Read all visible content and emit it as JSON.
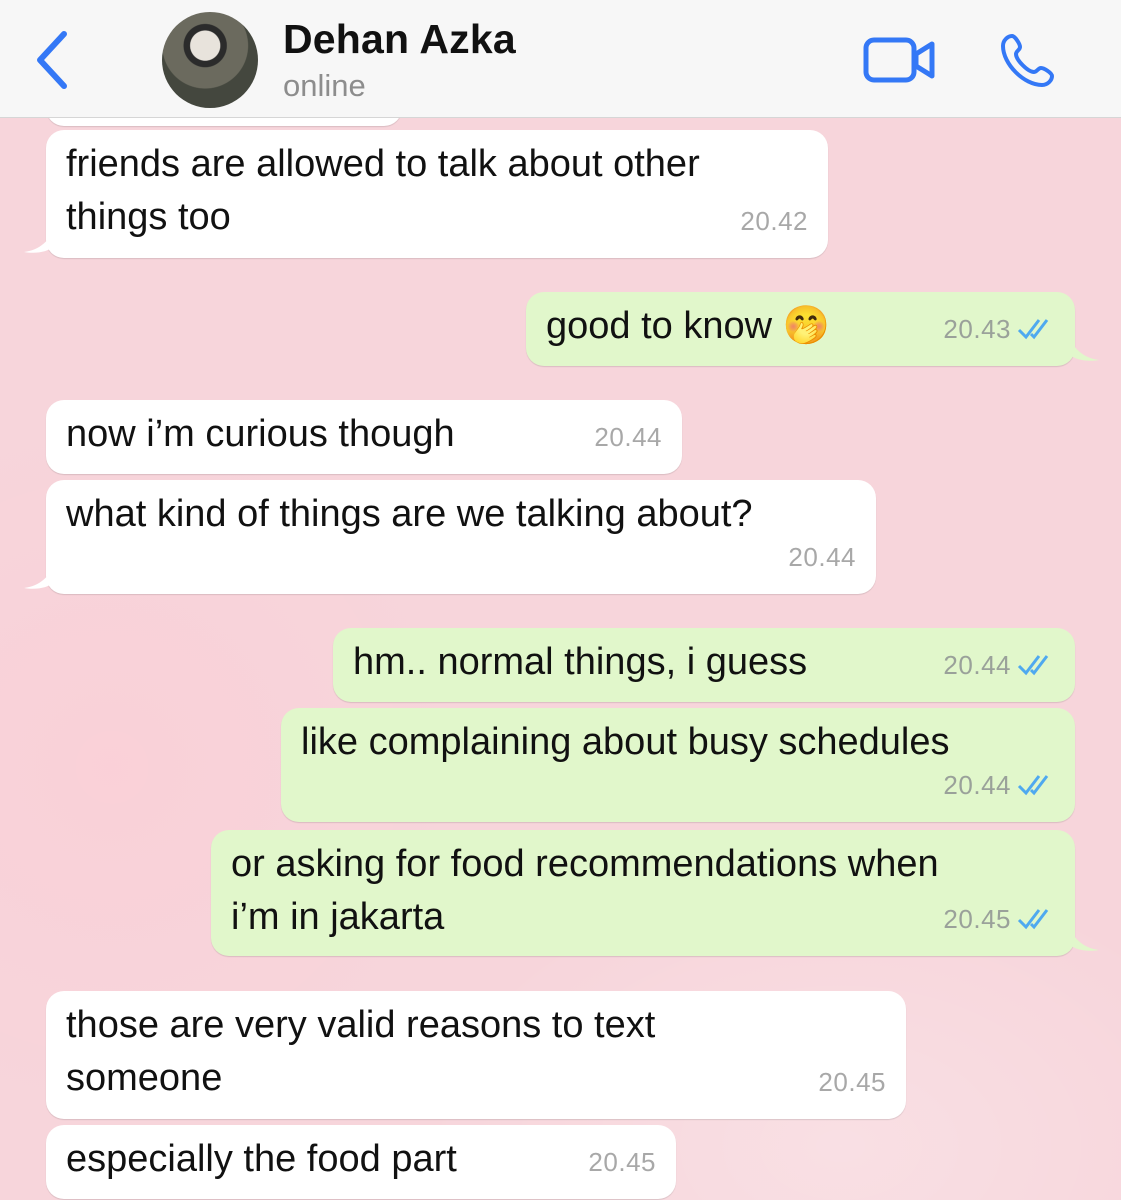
{
  "header": {
    "back_icon": "chevron-left-icon",
    "contact_name": "Dehan Azka",
    "status": "online",
    "video_icon": "video-camera-icon",
    "call_icon": "phone-icon",
    "accent_color": "#3478f6"
  },
  "colors": {
    "incoming_bubble": "#ffffff",
    "outgoing_bubble": "#e1f7cb",
    "chat_background": "#f7d5db",
    "read_ticks": "#4fa9ef"
  },
  "messages": [
    {
      "direction": "in",
      "text": "friends are allowed to talk about other\nthings too",
      "time": "20.42"
    },
    {
      "direction": "out",
      "text": "good to know 🤭",
      "time": "20.43",
      "status": "read"
    },
    {
      "direction": "in",
      "text": "now i’m curious though",
      "time": "20.44"
    },
    {
      "direction": "in",
      "text": "what kind of things are we talking about?",
      "time": "20.44"
    },
    {
      "direction": "out",
      "text": "hm.. normal things, i guess",
      "time": "20.44",
      "status": "read"
    },
    {
      "direction": "out",
      "text": "like complaining about busy schedules",
      "time": "20.44",
      "status": "read"
    },
    {
      "direction": "out",
      "text": "or asking for food recommendations when\ni’m in jakarta",
      "time": "20.45",
      "status": "read"
    },
    {
      "direction": "in",
      "text": "those are very valid reasons to text\nsomeone",
      "time": "20.45"
    },
    {
      "direction": "in",
      "text": "especially the food part",
      "time": "20.45"
    }
  ]
}
